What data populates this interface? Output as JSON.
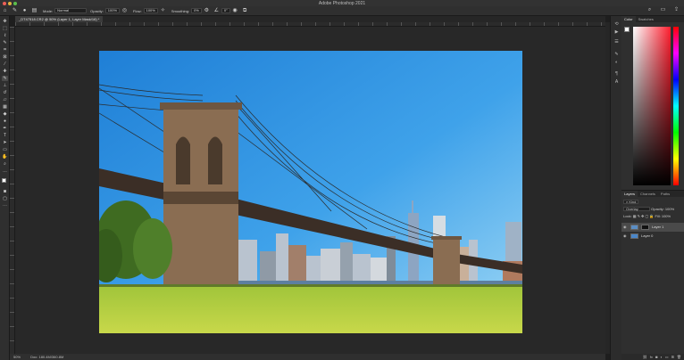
{
  "window": {
    "title": "Adobe Photoshop 2021"
  },
  "options_bar": {
    "mode_label": "Mode:",
    "mode_value": "Normal",
    "opacity_label": "Opacity:",
    "opacity_value": "100%",
    "flow_label": "Flow:",
    "flow_value": "100%",
    "smoothing_label": "Smoothing:",
    "smoothing_value": "0%",
    "angle_value": "0°"
  },
  "document": {
    "tab_label": "_DT47518.CR2 @ 50% (Layer 1, Layer Mask/16) *"
  },
  "status_bar": {
    "zoom": "50%",
    "doc_info": "Doc: 180.4M/360.8M"
  },
  "color_panel": {
    "tabs": [
      "Color",
      "Swatches"
    ],
    "foreground": "#ffffff",
    "background": "#000000"
  },
  "layers_panel": {
    "tabs": [
      "Layers",
      "Channels",
      "Paths"
    ],
    "kind_label": "Kind",
    "blend_mode": "Overlay",
    "opacity_label": "Opacity:",
    "opacity_value": "100%",
    "lock_label": "Lock:",
    "fill_label": "Fill:",
    "fill_value": "100%",
    "layers": [
      {
        "name": "Layer 1",
        "selected": true
      },
      {
        "name": "Layer 0",
        "selected": false
      }
    ]
  },
  "icons": {
    "tools": [
      "move-icon",
      "marquee-icon",
      "lasso-icon",
      "quick-select-icon",
      "crop-icon",
      "frame-icon",
      "eyedropper-icon",
      "healing-icon",
      "brush-icon",
      "stamp-icon",
      "history-brush-icon",
      "eraser-icon",
      "gradient-icon",
      "blur-icon",
      "dodge-icon",
      "pen-icon",
      "type-icon",
      "path-select-icon",
      "shape-icon",
      "hand-icon",
      "zoom-icon",
      "more-icon"
    ]
  }
}
